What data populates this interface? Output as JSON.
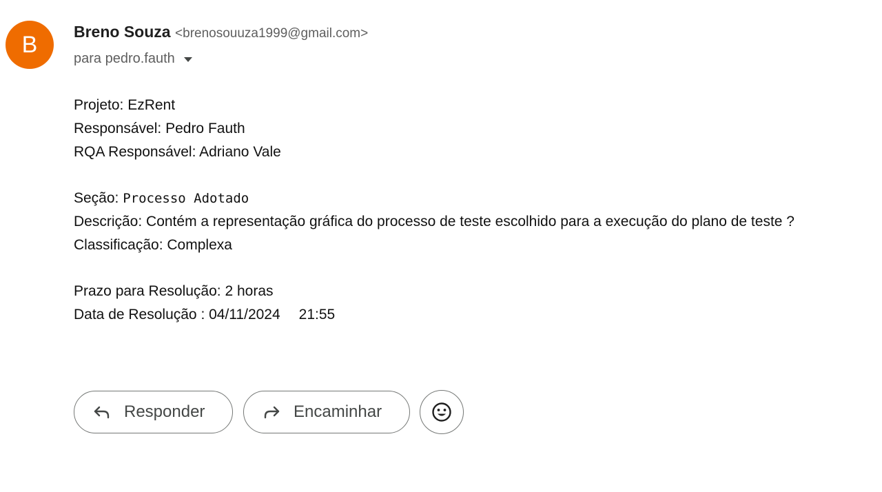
{
  "sender": {
    "avatar_letter": "B",
    "avatar_color": "#ef6c00",
    "name": "Breno Souza",
    "email": "<brenosouuza1999@gmail.com>"
  },
  "recipient": {
    "label": "para pedro.fauth",
    "toggle_icon": "caret-down-icon"
  },
  "message": {
    "project": "Projeto: EzRent",
    "responsible": "Responsável: Pedro Fauth",
    "rqa_responsible": "RQA Responsável: Adriano Vale",
    "section_label": "Seção: ",
    "section_value": "Processo Adotado",
    "description": "Descrição: Contém a representação gráfica do processo de teste escolhido para a execução do plano de teste ?",
    "classification": "Classificação: Complexa",
    "deadline": "Prazo para Resolução: 2 horas",
    "resolution_date_label": "Data de Resolução : 04/11/2024",
    "resolution_time": "21:55"
  },
  "actions": {
    "reply_label": "Responder",
    "reply_icon": "reply-arrow-icon",
    "forward_label": "Encaminhar",
    "forward_icon": "forward-arrow-icon",
    "emoji_icon": "smiley-emoji-icon"
  }
}
